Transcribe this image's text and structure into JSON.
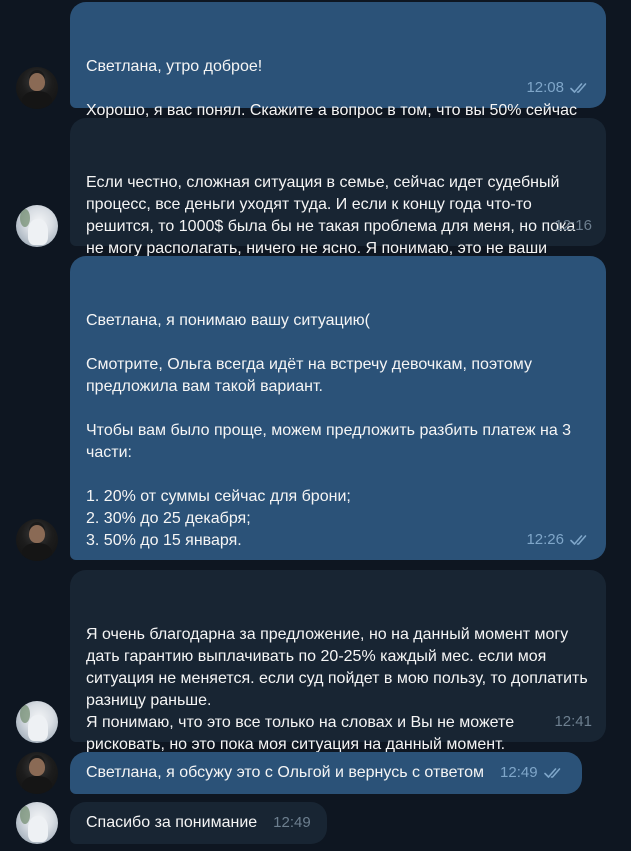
{
  "messages": [
    {
      "direction": "out",
      "text": "Светлана, утро доброе!\n\nХорошо, я вас понял. Скажите а вопрос в том, что вы 50% сейчас не можете оплатить?",
      "time": "12:08",
      "read_icon": "double-check-icon",
      "avatar": "man-avatar"
    },
    {
      "direction": "in",
      "text": "Если честно, сложная ситуация в семье, сейчас идет судебный процесс, все деньги уходят туда. И если к концу года что-то решится, то 1000$ была бы не такая проблема для меня, но пока не могу располагать, ничего не ясно. Я понимаю, это не ваши проблемы, просто объяснила ситуацию.",
      "time": "12:16",
      "avatar": "woman-avatar"
    },
    {
      "direction": "out",
      "text": "Светлана, я понимаю вашу ситуацию(\n\nСмотрите, Ольга всегда идёт на встречу девочкам, поэтому предложила вам такой вариант.\n\nЧтобы вам было проще, можем предложить разбить платеж на 3 части:\n\n1. 20% от суммы сейчас для брони;\n2. 30% до 25 декабря;\n3. 50% до 15 января.\n\nВас так устроит?",
      "time": "12:26",
      "read_icon": "double-check-icon",
      "avatar": "man-avatar"
    },
    {
      "direction": "in",
      "text": "Я очень благодарна за предложение, но на данный момент могу дать гарантию выплачивать по 20-25% каждый мес. если моя ситуация не меняется. если суд пойдет в мою пользу, то доплатить разницу раньше.\nЯ понимаю, что это все только на словах и Вы не можете рисковать, но это пока моя ситуация на данный момент.\nСпасибо за предложение.",
      "time": "12:41",
      "avatar": "woman-avatar"
    },
    {
      "direction": "out",
      "text": "Светлана, я обсужу это с Ольгой и вернусь с ответом",
      "time": "12:49",
      "read_icon": "double-check-icon",
      "avatar": "man-avatar"
    },
    {
      "direction": "in",
      "text": "Спасибо за понимание",
      "time": "12:49",
      "avatar": "woman-avatar"
    }
  ],
  "colors": {
    "background": "#0e1621",
    "outgoing_bubble": "#2b5278",
    "incoming_bubble": "#182533",
    "outgoing_meta": "#7fa6c9",
    "incoming_meta": "#6d7f8f",
    "text": "#f5f5f5"
  }
}
